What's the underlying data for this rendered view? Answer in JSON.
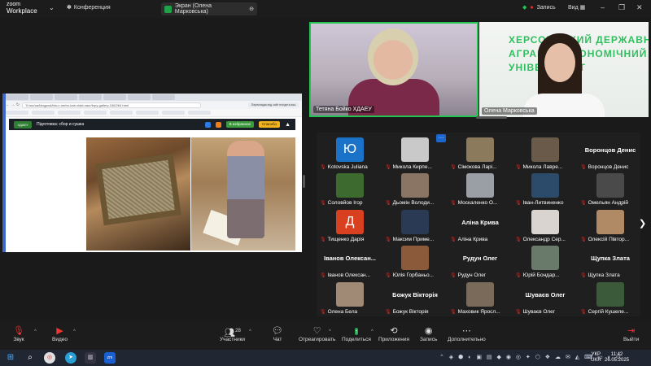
{
  "app": {
    "name_line1": "zoom",
    "name_line2": "Workplace",
    "conference_label": "Конференция"
  },
  "share_pill": {
    "label": "Экран (Олена Марковська)"
  },
  "top_right": {
    "record_label": "Запись",
    "view_label": "Вид"
  },
  "shared_screen": {
    "url": "ʼ0 bac/ua/blogpost/bia-n-nerbo-kab-vidal-naur/krpy-gallery-1562/64 html",
    "translate_label": "Перекладач від сайт погіднти-вьз",
    "site_logo": "ХДАЕУ",
    "site_title": "Підготовка: сбор и сушка",
    "btn_favorites": "В избранное",
    "btn_thanks": "Спасибо"
  },
  "videos": [
    {
      "name": "Тетяна Бойко ХДАЕУ"
    },
    {
      "name": "Олена Марковська",
      "wall_text": [
        "ХЕРСОНСЬКИЙ ДЕРЖАВНИЙ",
        "АГРАРНО-ЕКОНОМІЧНИЙ",
        "УНІВЕРСИТЕТ"
      ]
    }
  ],
  "gallery": {
    "more_button": "···",
    "participants": [
      {
        "name": "Kotovska Juliana",
        "avatar": "Ю",
        "color": "#1a73c9"
      },
      {
        "name": "Микола Кирпе...",
        "avatar": "",
        "color": "#c9c9c9"
      },
      {
        "name": "Сімокова Ларі...",
        "avatar": "",
        "color": "#8b7a5c"
      },
      {
        "name": "Микола Лавре...",
        "avatar": "",
        "color": "#6a5a4a"
      },
      {
        "name": "Воронцов Денис",
        "big": "Воронцов Денис"
      },
      {
        "name": "Соловйов Ігор",
        "avatar": "",
        "color": "#3d6a2e"
      },
      {
        "name": "Дьомін Володи...",
        "avatar": "",
        "color": "#8a7464"
      },
      {
        "name": "Москаленко О...",
        "avatar": "",
        "color": "#9a9fa6"
      },
      {
        "name": "Іван-Литвиненко",
        "avatar": "",
        "color": "#2c4a6a"
      },
      {
        "name": "Омельян Андрій",
        "avatar": "",
        "color": "#4a4a4a"
      },
      {
        "name": "Тищенко Дарія",
        "avatar": "Д",
        "color": "#d8401f"
      },
      {
        "name": "Максим Приме...",
        "avatar": "",
        "color": "#2a3a55"
      },
      {
        "name": "Аліна Крива",
        "big": "Аліна Крива"
      },
      {
        "name": "Олександр Сер...",
        "avatar": "",
        "color": "#d9d4cf"
      },
      {
        "name": "Олексій Півтор...",
        "avatar": "",
        "color": "#b08a64"
      },
      {
        "name": "Іванов Олексан...",
        "big": "Іванов Олексан..."
      },
      {
        "name": "Юлія Горбаньо...",
        "avatar": "",
        "color": "#8a5a3a"
      },
      {
        "name": "Рудун Олег",
        "big": "Рудун Олег"
      },
      {
        "name": "Юрій Бондар...",
        "avatar": "",
        "color": "#6a7a6a"
      },
      {
        "name": "Щупка Злата",
        "big": "Щупка Злата"
      },
      {
        "name": "Олена Бела",
        "avatar": "",
        "color": "#a08a76"
      },
      {
        "name": "Божук Вікторія",
        "big": "Божук Вікторія"
      },
      {
        "name": "Маховик Яросл...",
        "avatar": "",
        "color": "#7a6a5a"
      },
      {
        "name": "Шуваєв Олег",
        "big": "Шуваєв Олег"
      },
      {
        "name": "Сергій Кушеле...",
        "avatar": "",
        "color": "#3a5a3a"
      }
    ]
  },
  "toolbar": {
    "sound": "Звук",
    "video": "Видео",
    "participants": "Участники",
    "participants_count": "28",
    "chat": "Чат",
    "react": "Отреагировать",
    "share": "Поделиться",
    "apps": "Приложения",
    "record": "Запись",
    "more": "Дополнительно",
    "leave": "Выйти"
  },
  "taskbar": {
    "lang_line1": "УКР",
    "lang_line2": "UKR",
    "time": "11:42",
    "date": "26.05.2025"
  }
}
